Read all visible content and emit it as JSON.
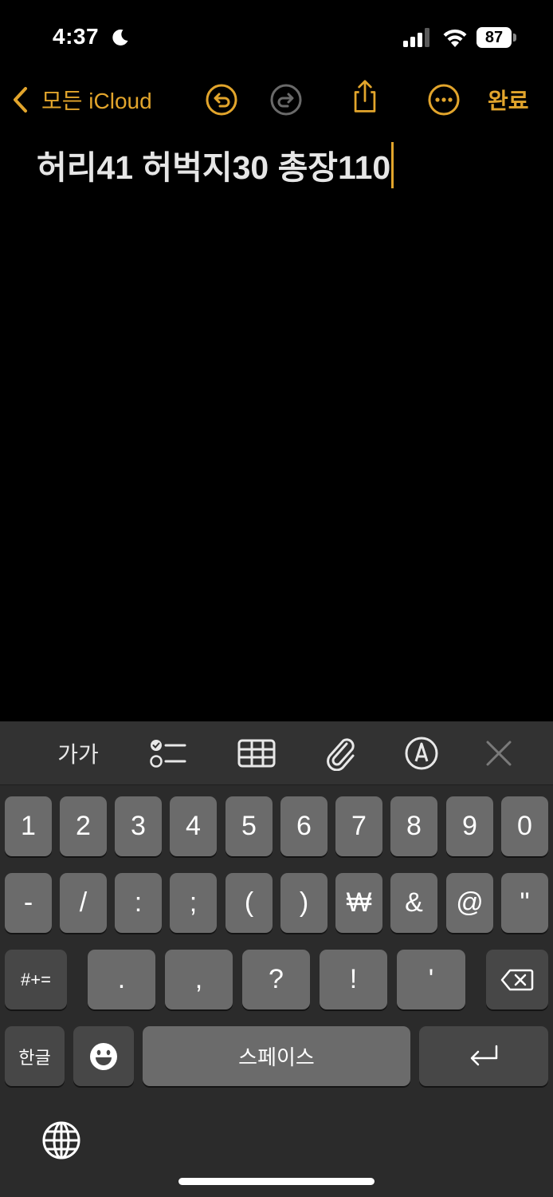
{
  "status_bar": {
    "time": "4:37",
    "battery_level": "87"
  },
  "nav": {
    "back_label": "모든 iCloud",
    "done_label": "완료"
  },
  "note": {
    "text": "허리41 허벅지30 총장110"
  },
  "toolbar": {
    "format_label": "가가"
  },
  "keyboard": {
    "row1": [
      "1",
      "2",
      "3",
      "4",
      "5",
      "6",
      "7",
      "8",
      "9",
      "0"
    ],
    "row2": [
      "-",
      "/",
      ":",
      ";",
      "(",
      ")",
      "₩",
      "&",
      "@",
      "\""
    ],
    "row3_mode": "#+=",
    "row3": [
      ".",
      ",",
      "?",
      "!",
      "'"
    ],
    "lang_key": "한글",
    "space_label": "스페이스"
  },
  "colors": {
    "accent": "#e2a52c",
    "background": "#000000",
    "keyboard_bg": "#2b2b2b",
    "key": "#6b6b6b",
    "key_dark": "#474747"
  },
  "icons": [
    "moon-icon",
    "signal-icon",
    "wifi-icon",
    "chevron-left-icon",
    "undo-icon",
    "redo-icon",
    "share-icon",
    "more-icon",
    "checklist-icon",
    "table-icon",
    "paperclip-icon",
    "markup-pen-icon",
    "close-icon",
    "delete-icon",
    "emoji-icon",
    "return-icon",
    "globe-icon"
  ]
}
